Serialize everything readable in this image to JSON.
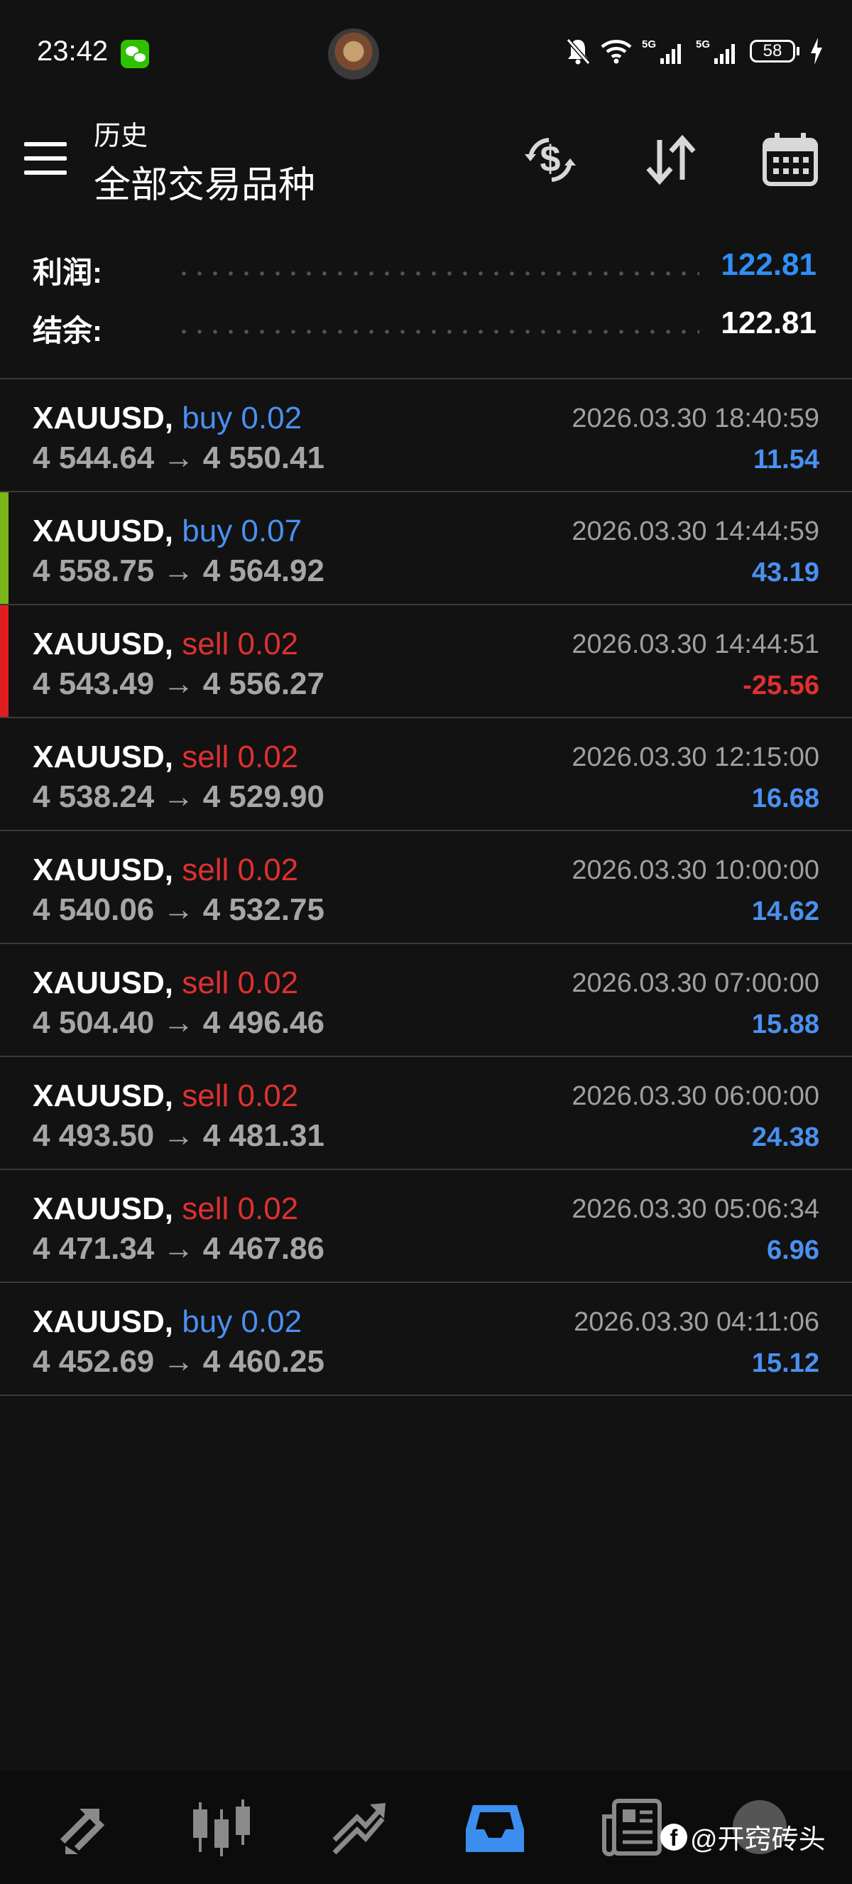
{
  "status_bar": {
    "time": "23:42",
    "signal_1_label": "5G",
    "signal_2_label": "5G",
    "battery": "58",
    "icons": [
      "wechat-icon",
      "avatar",
      "mute-icon",
      "wifi-icon",
      "signal-icon",
      "signal-icon",
      "battery-icon",
      "charging-icon"
    ]
  },
  "toolbar": {
    "subtitle": "历史",
    "title": "全部交易品种",
    "icons": [
      "menu-icon",
      "currency-exchange-icon",
      "sort-icon",
      "calendar-icon"
    ]
  },
  "summary": {
    "profit_label": "利润:",
    "profit_value": "122.81",
    "balance_label": "结余:",
    "balance_value": "122.81"
  },
  "colors": {
    "buy": "#4a90f0",
    "sell": "#e03030",
    "profit_positive": "#4a90f0",
    "profit_negative": "#e03030",
    "accent": "#2f8ff5",
    "marker_green": "#7cb518",
    "marker_red": "#e01e1e"
  },
  "trades": [
    {
      "symbol": "XAUUSD,",
      "side": "buy 0.02",
      "type": "buy",
      "prices": "4 544.64 → 4 550.41",
      "time": "2026.03.30 18:40:59",
      "profit": "11.54",
      "marker": ""
    },
    {
      "symbol": "XAUUSD,",
      "side": "buy 0.07",
      "type": "buy",
      "prices": "4 558.75 → 4 564.92",
      "time": "2026.03.30 14:44:59",
      "profit": "43.19",
      "marker": "green"
    },
    {
      "symbol": "XAUUSD,",
      "side": "sell 0.02",
      "type": "sell",
      "prices": "4 543.49 → 4 556.27",
      "time": "2026.03.30 14:44:51",
      "profit": "-25.56",
      "marker": "red"
    },
    {
      "symbol": "XAUUSD,",
      "side": "sell 0.02",
      "type": "sell",
      "prices": "4 538.24 → 4 529.90",
      "time": "2026.03.30 12:15:00",
      "profit": "16.68",
      "marker": ""
    },
    {
      "symbol": "XAUUSD,",
      "side": "sell 0.02",
      "type": "sell",
      "prices": "4 540.06 → 4 532.75",
      "time": "2026.03.30 10:00:00",
      "profit": "14.62",
      "marker": ""
    },
    {
      "symbol": "XAUUSD,",
      "side": "sell 0.02",
      "type": "sell",
      "prices": "4 504.40 → 4 496.46",
      "time": "2026.03.30 07:00:00",
      "profit": "15.88",
      "marker": ""
    },
    {
      "symbol": "XAUUSD,",
      "side": "sell 0.02",
      "type": "sell",
      "prices": "4 493.50 → 4 481.31",
      "time": "2026.03.30 06:00:00",
      "profit": "24.38",
      "marker": ""
    },
    {
      "symbol": "XAUUSD,",
      "side": "sell 0.02",
      "type": "sell",
      "prices": "4 471.34 → 4 467.86",
      "time": "2026.03.30 05:06:34",
      "profit": "6.96",
      "marker": ""
    },
    {
      "symbol": "XAUUSD,",
      "side": "buy 0.02",
      "type": "buy",
      "prices": "4 452.69 → 4 460.25",
      "time": "2026.03.30 04:11:06",
      "profit": "15.12",
      "marker": ""
    }
  ],
  "bottom_nav": {
    "items": [
      "quotes-icon",
      "chart-icon",
      "trade-icon",
      "history-icon",
      "news-icon",
      "messages-icon"
    ],
    "active": "history-icon"
  },
  "watermark": {
    "logo": "f",
    "text": "@开窍砖头"
  }
}
